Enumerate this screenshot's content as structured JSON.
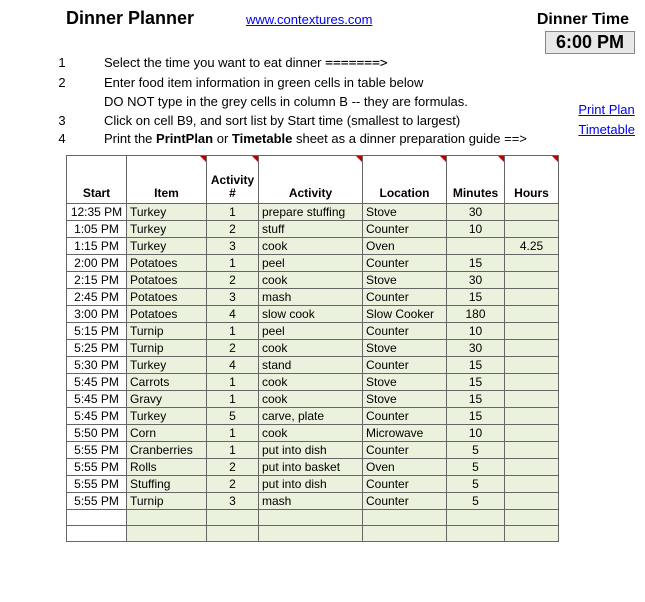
{
  "header": {
    "title": "Dinner Planner",
    "site_url": "www.contextures.com",
    "dinner_time_label": "Dinner Time",
    "dinner_time_value": "6:00 PM"
  },
  "instructions": [
    {
      "num": "1",
      "text_a": "Select the time you want to eat dinner",
      "arrow": "=======>",
      "text_b": ""
    },
    {
      "num": "2",
      "text_a": "Enter food item information in green cells in table below",
      "arrow": "",
      "text_b": ""
    },
    {
      "num": "",
      "text_a": "DO NOT type in the grey cells in column B -- they are formulas.",
      "arrow": "",
      "text_b": ""
    },
    {
      "num": "3",
      "text_a": "Click on cell B9, and sort list by Start time (smallest to largest)",
      "arrow": "",
      "text_b": ""
    },
    {
      "num": "4",
      "text_a": "Print the ",
      "bold1": "PrintPlan",
      "mid": " or ",
      "bold2": "Timetable",
      "text_b": " sheet as a dinner preparation guide ==>"
    }
  ],
  "side_links": {
    "print_plan": "Print Plan",
    "timetable": "Timetable"
  },
  "columns": {
    "start": "Start",
    "item": "Item",
    "activity_num": "Activity #",
    "activity": "Activity",
    "location": "Location",
    "minutes": "Minutes",
    "hours": "Hours"
  },
  "rows": [
    {
      "start": "12:35 PM",
      "item": "Turkey",
      "n": "1",
      "activity": "prepare stuffing",
      "loc": "Stove",
      "min": "30",
      "hours": ""
    },
    {
      "start": "1:05 PM",
      "item": "Turkey",
      "n": "2",
      "activity": "stuff",
      "loc": "Counter",
      "min": "10",
      "hours": ""
    },
    {
      "start": "1:15 PM",
      "item": "Turkey",
      "n": "3",
      "activity": "cook",
      "loc": "Oven",
      "min": "",
      "hours": "4.25"
    },
    {
      "start": "2:00 PM",
      "item": "Potatoes",
      "n": "1",
      "activity": "peel",
      "loc": "Counter",
      "min": "15",
      "hours": ""
    },
    {
      "start": "2:15 PM",
      "item": "Potatoes",
      "n": "2",
      "activity": "cook",
      "loc": "Stove",
      "min": "30",
      "hours": ""
    },
    {
      "start": "2:45 PM",
      "item": "Potatoes",
      "n": "3",
      "activity": "mash",
      "loc": "Counter",
      "min": "15",
      "hours": ""
    },
    {
      "start": "3:00 PM",
      "item": "Potatoes",
      "n": "4",
      "activity": "slow cook",
      "loc": "Slow Cooker",
      "min": "180",
      "hours": ""
    },
    {
      "start": "5:15 PM",
      "item": "Turnip",
      "n": "1",
      "activity": "peel",
      "loc": "Counter",
      "min": "10",
      "hours": ""
    },
    {
      "start": "5:25 PM",
      "item": "Turnip",
      "n": "2",
      "activity": "cook",
      "loc": "Stove",
      "min": "30",
      "hours": ""
    },
    {
      "start": "5:30 PM",
      "item": "Turkey",
      "n": "4",
      "activity": "stand",
      "loc": "Counter",
      "min": "15",
      "hours": ""
    },
    {
      "start": "5:45 PM",
      "item": "Carrots",
      "n": "1",
      "activity": "cook",
      "loc": "Stove",
      "min": "15",
      "hours": ""
    },
    {
      "start": "5:45 PM",
      "item": "Gravy",
      "n": "1",
      "activity": "cook",
      "loc": "Stove",
      "min": "15",
      "hours": ""
    },
    {
      "start": "5:45 PM",
      "item": "Turkey",
      "n": "5",
      "activity": "carve, plate",
      "loc": "Counter",
      "min": "15",
      "hours": ""
    },
    {
      "start": "5:50 PM",
      "item": "Corn",
      "n": "1",
      "activity": "cook",
      "loc": "Microwave",
      "min": "10",
      "hours": ""
    },
    {
      "start": "5:55 PM",
      "item": "Cranberries",
      "n": "1",
      "activity": "put into dish",
      "loc": "Counter",
      "min": "5",
      "hours": ""
    },
    {
      "start": "5:55 PM",
      "item": "Rolls",
      "n": "2",
      "activity": "put into basket",
      "loc": "Oven",
      "min": "5",
      "hours": ""
    },
    {
      "start": "5:55 PM",
      "item": "Stuffing",
      "n": "2",
      "activity": "put into dish",
      "loc": "Counter",
      "min": "5",
      "hours": ""
    },
    {
      "start": "5:55 PM",
      "item": "Turnip",
      "n": "3",
      "activity": "mash",
      "loc": "Counter",
      "min": "5",
      "hours": ""
    }
  ]
}
